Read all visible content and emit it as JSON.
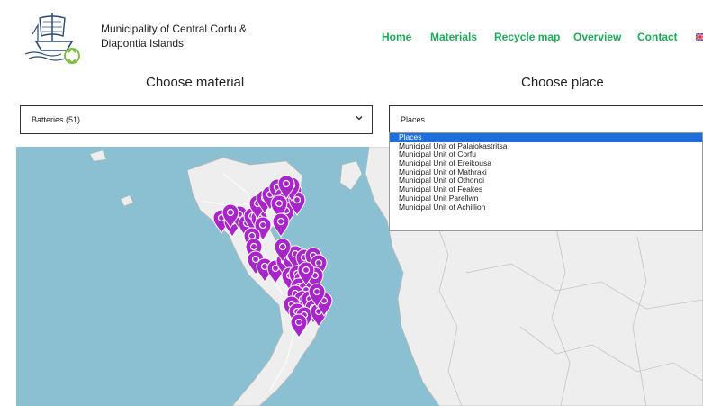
{
  "brand": {
    "line1": "Municipality of Central Corfu &",
    "line2": "Diapontia Islands"
  },
  "nav": {
    "items": [
      {
        "label": "Home"
      },
      {
        "label": "Materials"
      },
      {
        "label": "Recycle map"
      },
      {
        "label": "Overview"
      },
      {
        "label": "Contact"
      }
    ],
    "language_icon": "uk-flag-icon"
  },
  "material": {
    "title": "Choose material",
    "selected": "Batteries (51)"
  },
  "place": {
    "title": "Choose place",
    "selected": "Places",
    "options": [
      "Places",
      "Municipal Unit of Palaiokastritsa",
      "Municipal Unit of Corfu",
      "Municipal Unit of Ereikousa",
      "Municipal Unit of Mathraki",
      "Municipal Unit of Othonoi",
      "Municipal Unit of Feakes",
      "Municipal Unit Parellwn",
      "Municipal Unit of Achillion"
    ]
  },
  "map": {
    "marker_icon": "map-pin-icon",
    "marker_color": "#a826c9",
    "sea_color": "#8bbfd2",
    "land_color": "#eeeeee",
    "accent_color": "#1faa5a"
  }
}
